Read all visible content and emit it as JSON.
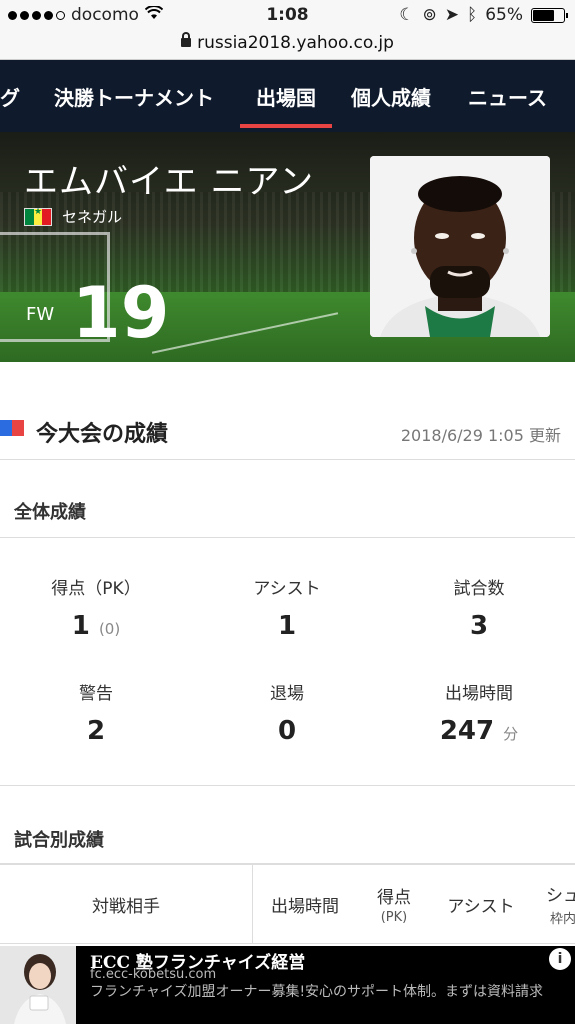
{
  "status_bar": {
    "carrier": "docomo",
    "time": "1:08",
    "battery": "65%",
    "battery_level": 0.65
  },
  "url": "russia2018.yahoo.co.jp",
  "nav": {
    "tabs": [
      {
        "label": "グ"
      },
      {
        "label": "決勝トーナメント"
      },
      {
        "label": "出場国",
        "active": true
      },
      {
        "label": "個人成績"
      },
      {
        "label": "ニュース"
      }
    ]
  },
  "player": {
    "name": "エムバイエ ニアン",
    "country": "セネガル",
    "position": "FW",
    "number": "19"
  },
  "section": {
    "title": "今大会の成績",
    "updated": "2018/6/29 1:05 更新"
  },
  "overall": {
    "title": "全体成績",
    "stats": [
      {
        "label": "得点（PK）",
        "value": "1",
        "sub": "(0)"
      },
      {
        "label": "アシスト",
        "value": "1",
        "sub": ""
      },
      {
        "label": "試合数",
        "value": "3",
        "sub": ""
      },
      {
        "label": "警告",
        "value": "2",
        "sub": ""
      },
      {
        "label": "退場",
        "value": "0",
        "sub": ""
      },
      {
        "label": "出場時間",
        "value": "247",
        "sub": "分"
      }
    ]
  },
  "per_match": {
    "title": "試合別成績",
    "columns": {
      "opponent": "対戦相手",
      "minutes": "出場時間",
      "goals": "得点",
      "goals_sub": "(PK)",
      "assist": "アシスト",
      "shots": "シュ",
      "shots_sub": "枠内"
    }
  },
  "ad": {
    "title": "ECC 塾フランチャイズ経営",
    "url": "fc.ecc-kobetsu.com",
    "desc": "フランチャイズ加盟オーナー募集!安心のサポート体制。まずは資料請求",
    "info": "i"
  }
}
